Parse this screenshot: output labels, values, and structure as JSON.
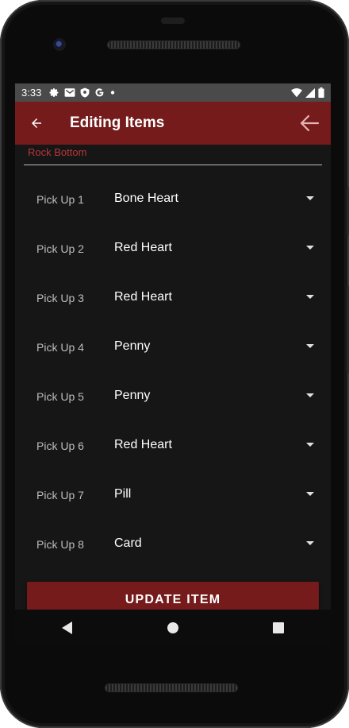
{
  "status_bar": {
    "time": "3:33",
    "icons": [
      "gear-icon",
      "mail-icon",
      "shield-icon",
      "google-icon",
      "dot-icon"
    ],
    "right_icons": [
      "wifi-icon",
      "signal-icon",
      "battery-icon"
    ]
  },
  "app_bar": {
    "title": "Editing Items",
    "back_icon": "arrow-left-icon",
    "action_icon": "arrow-left-icon"
  },
  "form": {
    "name_field_value": "Rock Bottom",
    "pickups": [
      {
        "label": "Pick Up 1",
        "value": "Bone Heart"
      },
      {
        "label": "Pick Up 2",
        "value": "Red Heart"
      },
      {
        "label": "Pick Up 3",
        "value": "Red Heart"
      },
      {
        "label": "Pick Up 4",
        "value": "Penny"
      },
      {
        "label": "Pick Up 5",
        "value": "Penny"
      },
      {
        "label": "Pick Up 6",
        "value": "Red Heart"
      },
      {
        "label": "Pick Up 7",
        "value": "Pill"
      },
      {
        "label": "Pick Up 8",
        "value": "Card"
      }
    ],
    "update_button_label": "UPDATE ITEM"
  },
  "nav_bar": {
    "icons": [
      "back-triangle-icon",
      "home-circle-icon",
      "recents-square-icon"
    ]
  },
  "colors": {
    "accent": "#751b1b",
    "field_text": "#b8363a",
    "background": "#161616"
  }
}
